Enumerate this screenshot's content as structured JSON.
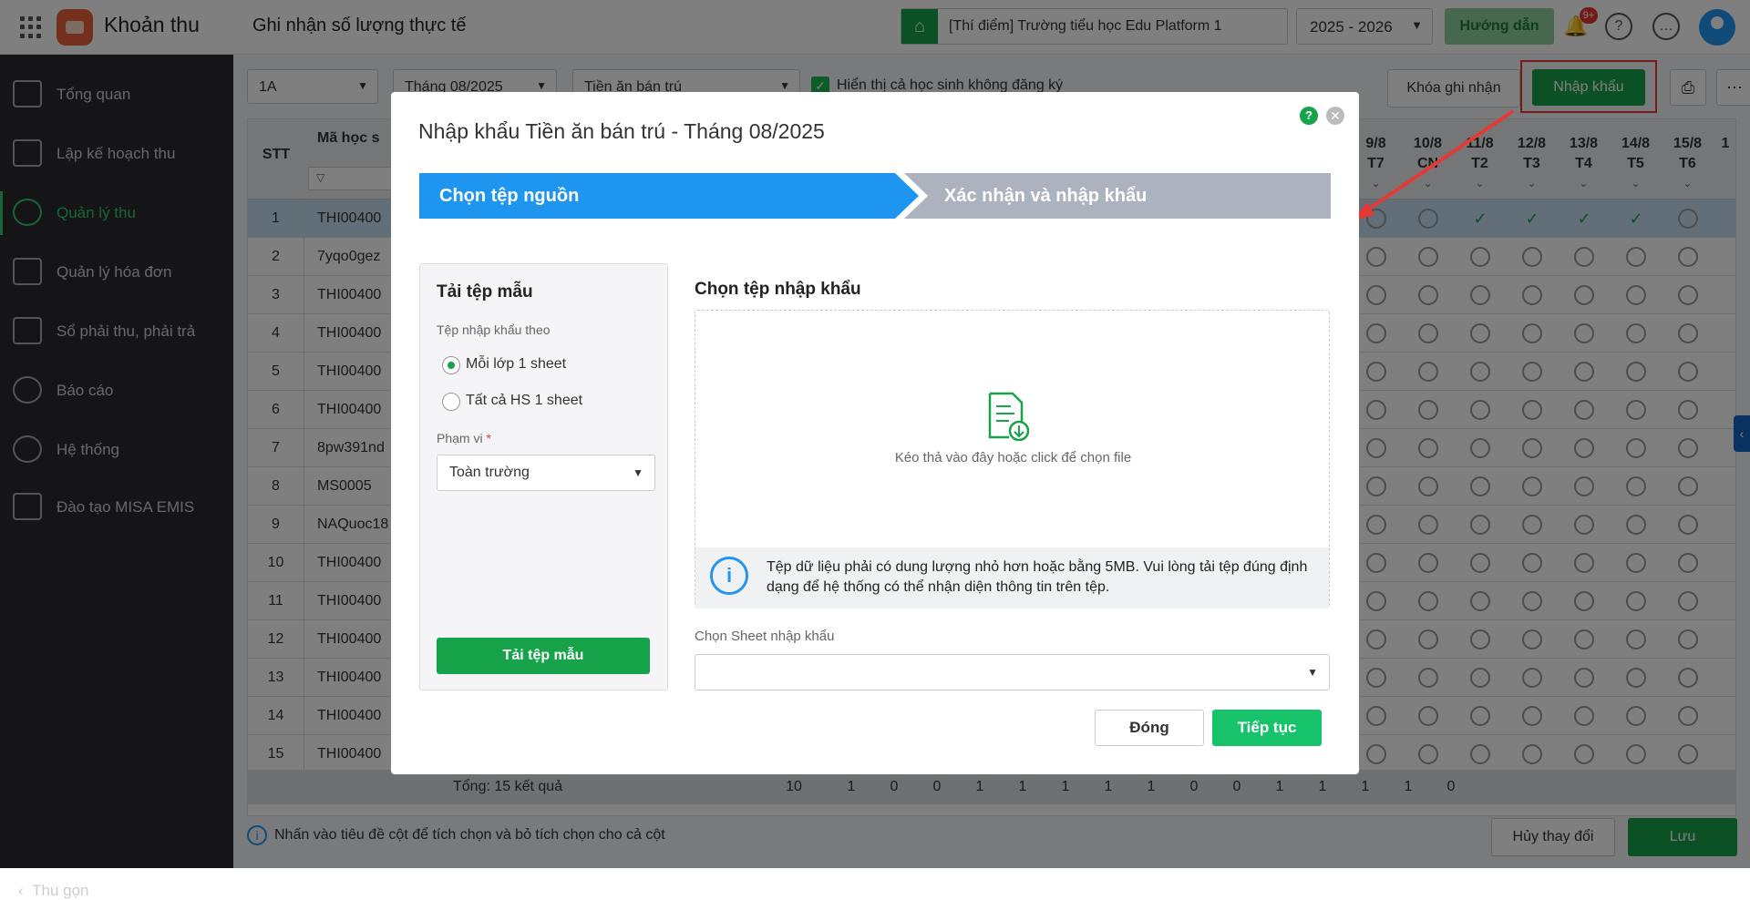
{
  "topbar": {
    "app_name": "Khoản thu",
    "page_title": "Ghi nhận số lượng thực tế",
    "school": "[Thí điểm] Trường tiểu học Edu Platform 1",
    "year": "2025 - 2026",
    "guide": "Hướng dẫn",
    "notif_badge": "9+"
  },
  "sidebar": {
    "items": [
      {
        "label": "Tổng quan"
      },
      {
        "label": "Lập kế hoạch thu"
      },
      {
        "label": "Quản lý thu"
      },
      {
        "label": "Quản lý hóa đơn"
      },
      {
        "label": "Sổ phải thu, phải trả"
      },
      {
        "label": "Báo cáo"
      },
      {
        "label": "Hệ thống"
      },
      {
        "label": "Đào tạo MISA EMIS"
      }
    ],
    "collapse": "Thu gọn"
  },
  "filters": {
    "class": "1A",
    "month": "Tháng 08/2025",
    "fee": "Tiền ăn bán trú",
    "show_unregistered": "Hiển thị cả học sinh không đăng ký",
    "lock_btn": "Khóa ghi nhận",
    "import_btn": "Nhập khẩu"
  },
  "table": {
    "col_stt": "STT",
    "col_code": "Mã học s",
    "days": [
      {
        "d": "9/8",
        "w": "T7"
      },
      {
        "d": "10/8",
        "w": "CN"
      },
      {
        "d": "11/8",
        "w": "T2"
      },
      {
        "d": "12/8",
        "w": "T3"
      },
      {
        "d": "13/8",
        "w": "T4"
      },
      {
        "d": "14/8",
        "w": "T5"
      },
      {
        "d": "15/8",
        "w": "T6"
      },
      {
        "d": "1",
        "w": ""
      }
    ],
    "rows": [
      {
        "stt": "1",
        "code": "THI00400"
      },
      {
        "stt": "2",
        "code": "7yqo0gez"
      },
      {
        "stt": "3",
        "code": "THI00400"
      },
      {
        "stt": "4",
        "code": "THI00400"
      },
      {
        "stt": "5",
        "code": "THI00400"
      },
      {
        "stt": "6",
        "code": "THI00400"
      },
      {
        "stt": "7",
        "code": "8pw391nd"
      },
      {
        "stt": "8",
        "code": "MS0005"
      },
      {
        "stt": "9",
        "code": "NAQuoc18"
      },
      {
        "stt": "10",
        "code": "THI00400"
      },
      {
        "stt": "11",
        "code": "THI00400"
      },
      {
        "stt": "12",
        "code": "THI00400"
      },
      {
        "stt": "13",
        "code": "THI00400"
      },
      {
        "stt": "14",
        "code": "THI00400"
      },
      {
        "stt": "15",
        "code": "THI00400"
      }
    ],
    "total_label": "Tổng: 15 kết quả",
    "totals": [
      "10",
      "1",
      "0",
      "0",
      "1",
      "1",
      "1",
      "1",
      "1",
      "0",
      "0",
      "1",
      "1",
      "1",
      "1",
      "0"
    ]
  },
  "footer": {
    "hint": "Nhấn vào tiêu đề cột để tích chọn và bỏ tích chọn cho cả cột",
    "cancel": "Hủy thay đổi",
    "save": "Lưu"
  },
  "modal": {
    "title": "Nhập khẩu Tiền ăn bán trú - Tháng 08/2025",
    "step1": "Chọn tệp nguồn",
    "step2": "Xác nhận và nhập khẩu",
    "template_title": "Tải tệp mẫu",
    "import_by": "Tệp nhập khẩu theo",
    "opt1": "Mỗi lớp 1 sheet",
    "opt2": "Tất cả HS 1 sheet",
    "scope_label": "Phạm vi",
    "scope_req": "*",
    "scope_value": "Toàn trường",
    "download_btn": "Tải tệp mẫu",
    "choose_title": "Chọn tệp nhập khẩu",
    "drop_text": "Kéo thả vào đây hoặc click để chọn file",
    "info": "Tệp dữ liệu phải có dung lượng nhỏ hơn hoặc bằng 5MB. Vui lòng tải tệp đúng định dạng để hệ thống có thể nhận diện thông tin trên tệp.",
    "sheet_label": "Chọn Sheet nhập khẩu",
    "close_btn": "Đóng",
    "next_btn": "Tiếp tục"
  },
  "colors": {
    "accent": "#16a34a",
    "step_active": "#1e96f0",
    "highlight": "#e53935"
  }
}
